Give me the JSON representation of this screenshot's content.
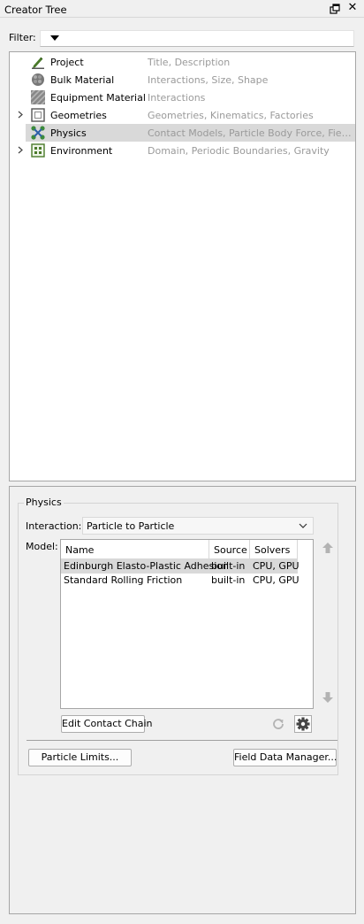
{
  "window": {
    "title": "Creator Tree",
    "float_icon": "float-window-icon",
    "close_icon": "close-icon",
    "close_glyph": "✕"
  },
  "filter": {
    "label": "Filter:",
    "value": ""
  },
  "tree": {
    "items": [
      {
        "name": "Project",
        "desc": "Title, Description",
        "icon": "pencil-icon",
        "expandable": false,
        "selected": false
      },
      {
        "name": "Bulk Material",
        "desc": "Interactions, Size, Shape",
        "icon": "particle-sphere-icon",
        "expandable": false,
        "selected": false
      },
      {
        "name": "Equipment Material",
        "desc": "Interactions",
        "icon": "hatched-square-icon",
        "expandable": false,
        "selected": false
      },
      {
        "name": "Geometries",
        "desc": "Geometries, Kinematics, Factories",
        "icon": "geometry-box-icon",
        "expandable": true,
        "selected": false
      },
      {
        "name": "Physics",
        "desc": "Contact Models, Particle Body Force, Field...",
        "icon": "physics-contacts-icon",
        "expandable": false,
        "selected": true
      },
      {
        "name": "Environment",
        "desc": "Domain, Periodic Boundaries, Gravity",
        "icon": "environment-domain-icon",
        "expandable": true,
        "selected": false
      }
    ]
  },
  "physics": {
    "group_title": "Physics",
    "interaction_label": "Interaction:",
    "interaction_value": "Particle to Particle",
    "model_label": "Model:",
    "table": {
      "columns": [
        "Name",
        "Source",
        "Solvers"
      ],
      "rows": [
        [
          "Edinburgh Elasto-Plastic Adhesion",
          "built-in",
          "CPU, GPU"
        ],
        [
          "Standard Rolling Friction",
          "built-in",
          "CPU, GPU"
        ]
      ],
      "selected_row": 0
    },
    "edit_contact_chain": "Edit Contact Chain",
    "particle_limits": "Particle Limits...",
    "field_data_manager": "Field Data Manager..."
  },
  "colors": {
    "selection": "#d9d9d9",
    "description_text": "#9a9a9a",
    "panel_bg": "#f0f0f0",
    "border": "#a6a6a6"
  }
}
